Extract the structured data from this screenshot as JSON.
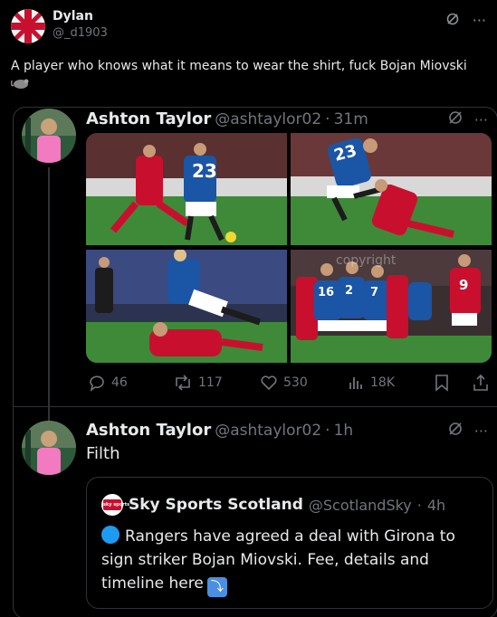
{
  "tweet": {
    "author_name": "Dylan",
    "author_handle": "@_d1903",
    "text": "A player who knows what it means to wear the shirt, fuck Bojan Miovski",
    "emoji": "rat"
  },
  "embedded_post": {
    "author_name": "Ashton Taylor",
    "author_handle": "@ashtaylor02",
    "separator": "·",
    "time": "31m",
    "photo_shirt_numbers": [
      "23",
      "23",
      "7",
      "16",
      "2",
      "9"
    ],
    "photo_watermark": "copyright",
    "stats": {
      "replies": "46",
      "reposts": "117",
      "likes": "530",
      "views": "18K"
    }
  },
  "reply_post": {
    "author_name": "Ashton Taylor",
    "author_handle": "@ashtaylor02",
    "separator": "·",
    "time": "1h",
    "text": "Filth"
  },
  "quoted_post": {
    "author_name": "Sky Sports Scotland",
    "author_handle": "@ScotlandSky",
    "separator": "·",
    "time": "4h",
    "logo_text": "sky sports",
    "text": "Rangers have agreed a deal with Girona to sign striker Bojan Miovski. Fee, details and timeline here"
  },
  "colors": {
    "background": "#000000",
    "text": "#e7e9ea",
    "secondary": "#71767b",
    "border": "#2f3336",
    "rangers_blue": "#1b55a6",
    "aberdeen_red": "#c8102e"
  }
}
